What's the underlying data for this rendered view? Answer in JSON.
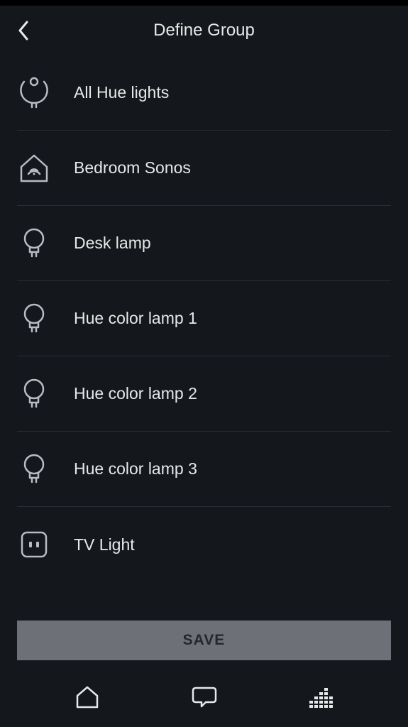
{
  "header": {
    "title": "Define Group"
  },
  "devices": [
    {
      "label": "All Hue lights",
      "icon": "hue-group-icon"
    },
    {
      "label": "Bedroom Sonos",
      "icon": "speaker-house-icon"
    },
    {
      "label": "Desk lamp",
      "icon": "bulb-icon"
    },
    {
      "label": "Hue color lamp 1",
      "icon": "bulb-icon"
    },
    {
      "label": "Hue color lamp 2",
      "icon": "bulb-icon"
    },
    {
      "label": "Hue color lamp 3",
      "icon": "bulb-icon"
    },
    {
      "label": "TV Light",
      "icon": "plug-icon"
    }
  ],
  "actions": {
    "save_label": "SAVE"
  },
  "tabbar": {
    "home": "home-icon",
    "chat": "chat-icon",
    "music": "equalizer-icon"
  }
}
